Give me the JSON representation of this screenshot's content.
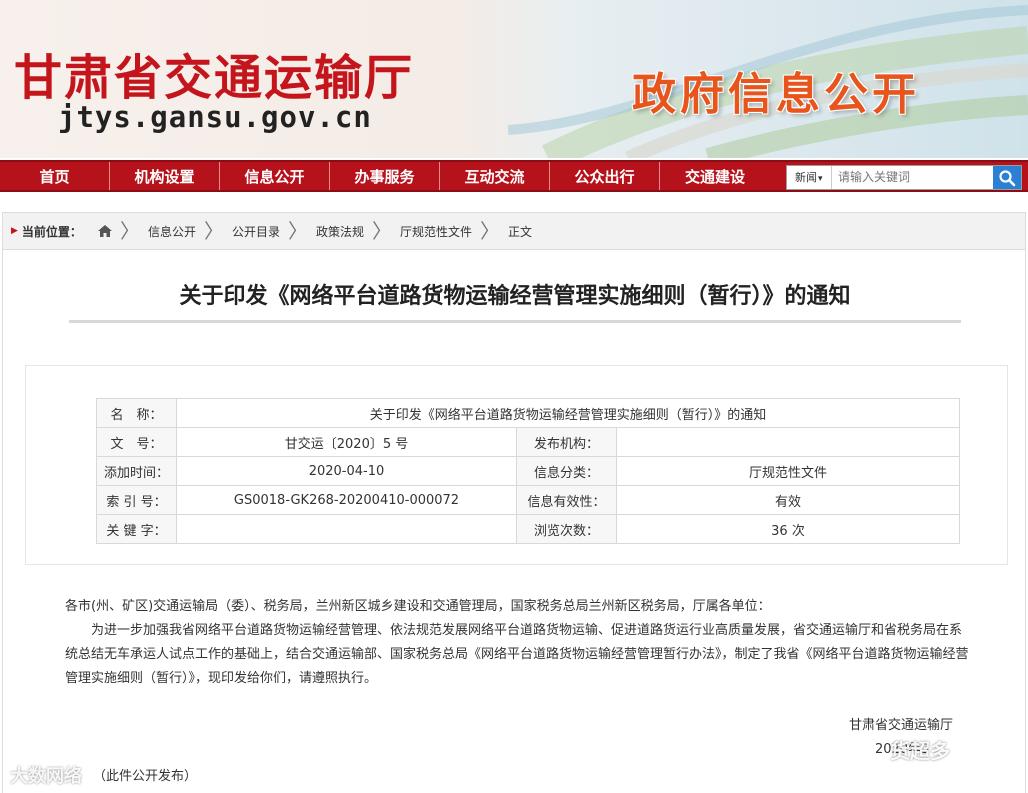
{
  "header": {
    "site_title": "甘肃省交通运输厅",
    "site_url": "jtys.gansu.gov.cn",
    "section_banner": "政府信息公开"
  },
  "nav": {
    "items": [
      "首页",
      "机构设置",
      "信息公开",
      "办事服务",
      "互动交流",
      "公众出行",
      "交通建设"
    ]
  },
  "search": {
    "scope": "新闻",
    "placeholder": "请输入关键词",
    "icon": "search-icon"
  },
  "breadcrumb": {
    "label": "当前位置：",
    "home_icon": "home-icon",
    "items": [
      "信息公开",
      "公开目录",
      "政策法规",
      "厅规范性文件",
      "正文"
    ]
  },
  "article": {
    "title": "关于印发《网络平台道路货物运输经营管理实施细则（暂行）》的通知",
    "meta": {
      "name_label": "名　称：",
      "name_value": "关于印发《网络平台道路货物运输经营管理实施细则（暂行）》的通知",
      "doc_no_label": "文　号：",
      "doc_no_value": "甘交运〔2020〕5 号",
      "publisher_label": "发布机构：",
      "publisher_value": "",
      "added_label": "添加时间：",
      "added_value": "2020-04-10",
      "category_label": "信息分类：",
      "category_value": "厅规范性文件",
      "index_label": "索 引 号：",
      "index_value": "GS0018-GK268-20200410-000072",
      "validity_label": "信息有效性：",
      "validity_value": "有效",
      "keyword_label": "关 键 字：",
      "keyword_value": "",
      "views_label": "浏览次数：",
      "views_value": "36 次"
    },
    "salutation": "各市(州、矿区)交通运输局（委）、税务局，兰州新区城乡建设和交通管理局，国家税务总局兰州新区税务局，厅属各单位：",
    "paragraph": "为进一步加强我省网络平台道路货物运输经营管理、依法规范发展网络平台道路货物运输、促进道路货运行业高质量发展，省交通运输厅和省税务局在系统总结无车承运人试点工作的基础上，结合交通运输部、国家税务总局《网络平台道路货物运输经营管理暂行办法》，制定了我省《网络平台道路货物运输经营管理实施细则（暂行）》，现印发给你们，请遵照执行。",
    "signer": "甘肃省交通运输厅",
    "date_partial": "2020年3",
    "release": "（此件公开发布）"
  },
  "watermarks": {
    "left": "大数网络",
    "right": "货超多"
  },
  "colors": {
    "brand_red": "#b6121b",
    "title_red": "#c4151c",
    "banner_orange": "#e7551c",
    "search_blue": "#2b7fd4"
  }
}
